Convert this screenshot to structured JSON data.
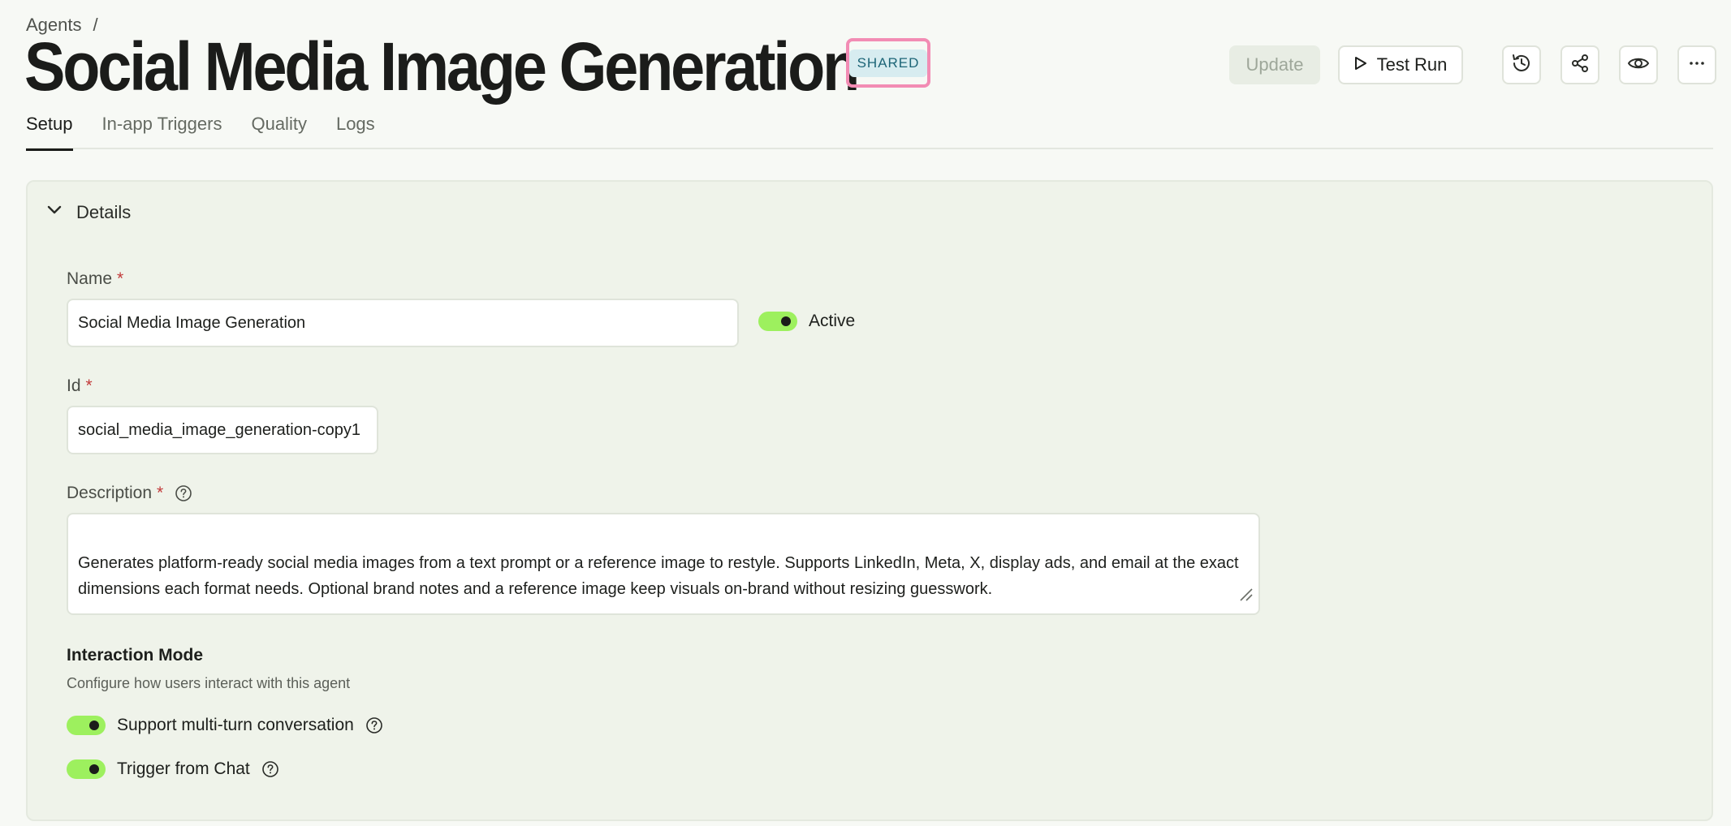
{
  "breadcrumb": {
    "parent": "Agents",
    "separator": "/"
  },
  "header": {
    "title": "Social Media Image Generation",
    "badge": "SHARED",
    "update_label": "Update",
    "test_run_label": "Test Run"
  },
  "icons": {
    "history": "history-icon",
    "share": "share-icon",
    "preview": "eye-icon",
    "more": "more-icon"
  },
  "tabs": [
    {
      "label": "Setup",
      "active": true
    },
    {
      "label": "In-app Triggers",
      "active": false
    },
    {
      "label": "Quality",
      "active": false
    },
    {
      "label": "Logs",
      "active": false
    }
  ],
  "details": {
    "section_label": "Details",
    "name_label": "Name",
    "name_value": "Social Media Image Generation",
    "active_label": "Active",
    "active": true,
    "id_label": "Id",
    "id_value": "social_media_image_generation-copy1",
    "description_label": "Description",
    "description_value": "Generates platform-ready social media images from a text prompt or a reference image to restyle. Supports LinkedIn, Meta, X, display ads, and email at the exact dimensions each format needs. Optional brand notes and a reference image keep visuals on-brand without resizing guesswork.",
    "required_marker": "*"
  },
  "interaction_mode": {
    "title": "Interaction Mode",
    "subtitle": "Configure how users interact with this agent",
    "options": [
      {
        "label": "Support multi-turn conversation",
        "enabled": true
      },
      {
        "label": "Trigger from Chat",
        "enabled": true
      }
    ]
  },
  "colors": {
    "toggle_on": "#9df05e",
    "badge_bg": "#d7ecf0",
    "badge_border": "#f28cb4",
    "required": "#c23a3a"
  }
}
